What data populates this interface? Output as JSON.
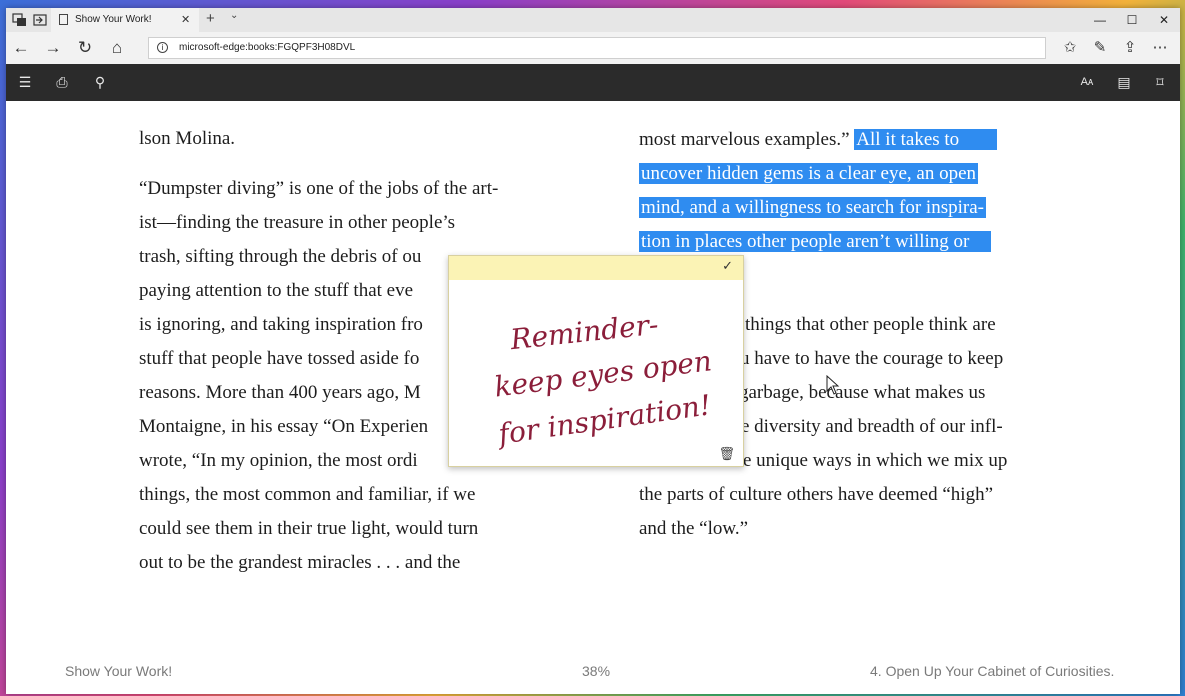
{
  "browser": {
    "tab_title": "Show Your Work!",
    "tab_close": "✕",
    "new_tab": "+",
    "tab_menu": "⌄",
    "window_controls": {
      "minimize": "—",
      "maximize": "☐",
      "close": "✕"
    },
    "address": "microsoft-edge:books:FGQPF3H08DVL",
    "info_glyph": "i"
  },
  "nav": {
    "back_icon": "←",
    "forward_icon": "→",
    "refresh_icon": "↻",
    "home_icon": "⌂",
    "favorites_icon": "✩",
    "pen_icon": "✎",
    "share_icon": "⇪",
    "more_icon": "⋯"
  },
  "reader": {
    "toc_icon": "☰",
    "bookmarks_icon": "⎙",
    "search_icon": "⚲",
    "text_options_icon": "Aᴀ",
    "read_aloud_icon": "▤",
    "bookmark_icon": "⌑"
  },
  "book": {
    "left_lines": [
      "lson Molina.",
      "“Dumpster diving” is one of the jobs of the art-",
      "ist—finding the treasure in other people’s",
      "trash, sifting through the debris of ou",
      "paying attention to the stuff that eve",
      "is ignoring, and taking inspiration fro",
      "stuff that people have tossed aside fo",
      "reasons. More than 400 years ago, M",
      "Montaigne, in his essay “On Experien",
      "wrote, “In my opinion, the most ordi",
      "things, the most common and familiar, if we",
      "could see them in their true light, would turn",
      "out to be the grandest miracles . . . and the"
    ],
    "right_first_plain": "most marvelous examples.” ",
    "right_first_highlight": "All it takes to",
    "right_highlight_lines": [
      "uncover hidden gems is a clear eye, an open",
      "mind, and a willingness to search for inspira-",
      "tion in places other people aren’t willing or"
    ],
    "right_lines": [
      "things that other people think are",
      "u have to have the courage to keep",
      "garbage, because what makes us",
      "e diversity and breadth of our infl-",
      "e unique ways in which we mix up",
      "the parts of culture others have deemed “high”",
      "and the “low.”"
    ],
    "highlight_color": "#2f8cf0"
  },
  "note": {
    "check_icon": "✓",
    "trash_icon": "🗑",
    "handwriting": [
      "Reminder-",
      "keep eyes open",
      "for inspiration!"
    ],
    "ink_color": "#8b1e3a",
    "header_color": "#fbf3b5"
  },
  "footer": {
    "book_title": "Show Your Work!",
    "progress": "38%",
    "chapter": "4. Open Up Your Cabinet of Curiosities."
  }
}
